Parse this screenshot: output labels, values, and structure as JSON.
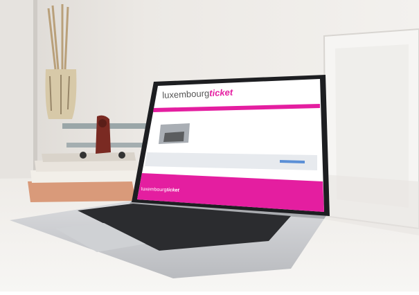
{
  "site": {
    "logo_part1": "luxembourg",
    "logo_part2": "ticket"
  },
  "colors": {
    "brand": "#e41ea0",
    "wall": "#ece8e4",
    "desk": "#f1efec"
  }
}
